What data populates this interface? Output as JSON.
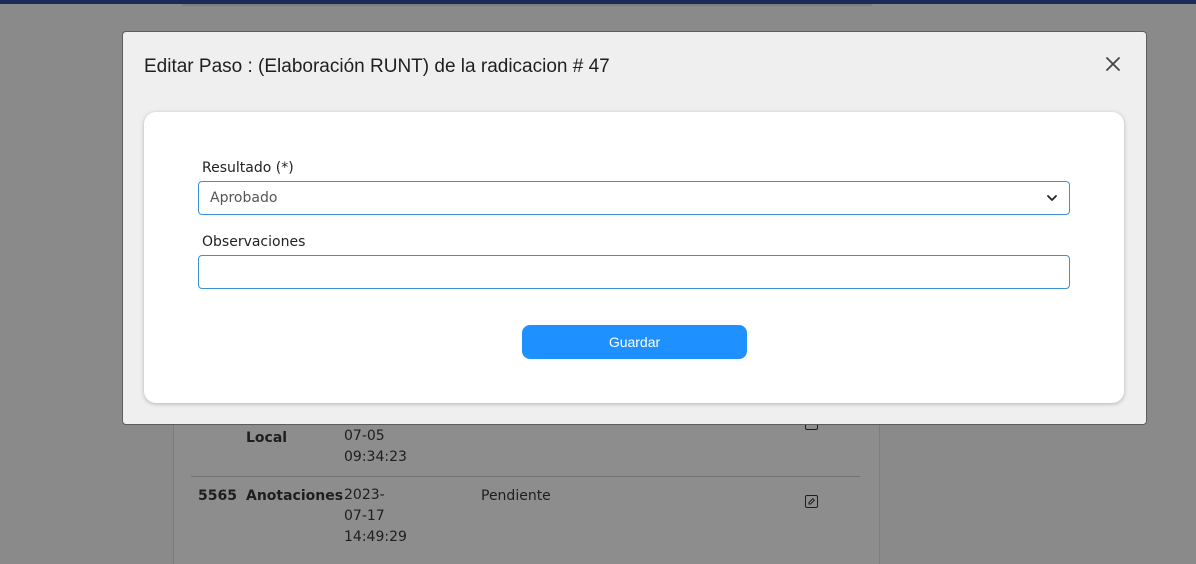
{
  "modal": {
    "title": "Editar Paso : (Elaboración RUNT) de la radicacion # 47",
    "close_icon": "close-icon",
    "form": {
      "resultado_label": "Resultado (*)",
      "resultado_value": "Aprobado",
      "observaciones_label": "Observaciones",
      "observaciones_value": "",
      "save_label": "Guardar"
    }
  },
  "background_table": {
    "rows": [
      {
        "id": "",
        "name": "Local",
        "date": [
          "07-05",
          "09:34:23"
        ],
        "state": ""
      },
      {
        "id": "5565",
        "name": "Anotaciones",
        "date": [
          "2023-",
          "07-17",
          "14:49:29"
        ],
        "state": "Pendiente"
      }
    ]
  },
  "colors": {
    "accent": "#1e90ff",
    "input_border": "#3d8fd6",
    "overlay": "#8a8a8a",
    "topbar": "#1d2a55"
  }
}
